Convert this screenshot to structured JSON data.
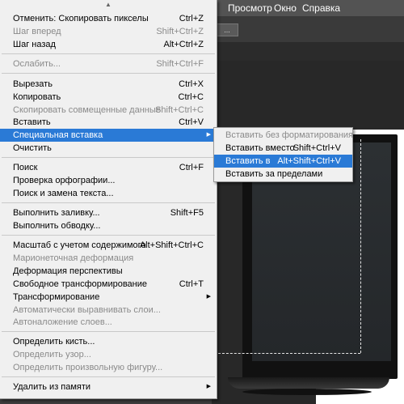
{
  "menubar": {
    "items": [
      "Просмотр",
      "Окно",
      "Справка"
    ]
  },
  "options_button": "...",
  "menu": {
    "scroll_up": "▲",
    "items": [
      {
        "label": "Отменить: Скопировать пикселы",
        "shortcut": "Ctrl+Z",
        "enabled": true
      },
      {
        "label": "Шаг вперед",
        "shortcut": "Shift+Ctrl+Z",
        "enabled": false
      },
      {
        "label": "Шаг назад",
        "shortcut": "Alt+Ctrl+Z",
        "enabled": true
      },
      {
        "label": "Ослабить...",
        "shortcut": "Shift+Ctrl+F",
        "enabled": false
      },
      {
        "label": "Вырезать",
        "shortcut": "Ctrl+X",
        "enabled": true
      },
      {
        "label": "Копировать",
        "shortcut": "Ctrl+C",
        "enabled": true
      },
      {
        "label": "Скопировать совмещенные данные",
        "shortcut": "Shift+Ctrl+C",
        "enabled": false
      },
      {
        "label": "Вставить",
        "shortcut": "Ctrl+V",
        "enabled": true
      },
      {
        "label": "Специальная вставка",
        "shortcut": "",
        "enabled": true,
        "submenu": true,
        "highlighted": true
      },
      {
        "label": "Очистить",
        "shortcut": "",
        "enabled": true
      },
      {
        "label": "Поиск",
        "shortcut": "Ctrl+F",
        "enabled": true
      },
      {
        "label": "Проверка орфографии...",
        "shortcut": "",
        "enabled": true
      },
      {
        "label": "Поиск и замена текста...",
        "shortcut": "",
        "enabled": true
      },
      {
        "label": "Выполнить заливку...",
        "shortcut": "Shift+F5",
        "enabled": true
      },
      {
        "label": "Выполнить обводку...",
        "shortcut": "",
        "enabled": true
      },
      {
        "label": "Масштаб с учетом содержимого",
        "shortcut": "Alt+Shift+Ctrl+C",
        "enabled": true
      },
      {
        "label": "Марионеточная деформация",
        "shortcut": "",
        "enabled": false
      },
      {
        "label": "Деформация перспективы",
        "shortcut": "",
        "enabled": true
      },
      {
        "label": "Свободное трансформирование",
        "shortcut": "Ctrl+T",
        "enabled": true
      },
      {
        "label": "Трансформирование",
        "shortcut": "",
        "enabled": true,
        "submenu": true
      },
      {
        "label": "Автоматически выравнивать слои...",
        "shortcut": "",
        "enabled": false
      },
      {
        "label": "Автоналожение слоев...",
        "shortcut": "",
        "enabled": false
      },
      {
        "label": "Определить кисть...",
        "shortcut": "",
        "enabled": true
      },
      {
        "label": "Определить узор...",
        "shortcut": "",
        "enabled": false
      },
      {
        "label": "Определить произвольную фигуру...",
        "shortcut": "",
        "enabled": false
      },
      {
        "label": "Удалить из памяти",
        "shortcut": "",
        "enabled": true,
        "submenu": true
      }
    ]
  },
  "submenu": {
    "items": [
      {
        "label": "Вставить без форматирования",
        "shortcut": "",
        "enabled": false
      },
      {
        "label": "Вставить вместо",
        "shortcut": "Shift+Ctrl+V",
        "enabled": true
      },
      {
        "label": "Вставить в",
        "shortcut": "Alt+Shift+Ctrl+V",
        "enabled": true,
        "highlighted": true
      },
      {
        "label": "Вставить за пределами",
        "shortcut": "",
        "enabled": true
      }
    ]
  },
  "colors": {
    "highlight": "#2a7ad6",
    "menu_bg": "#f0f0f0",
    "disabled_text": "#8a8a8a"
  }
}
